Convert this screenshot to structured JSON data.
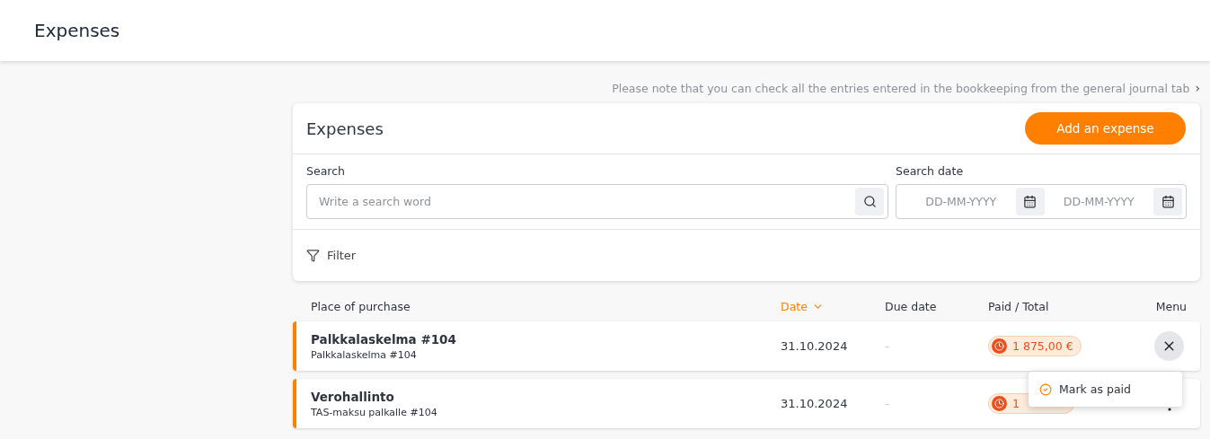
{
  "header": {
    "title": "Expenses"
  },
  "notice": {
    "text": "Please note that you can check all the entries entered in the bookkeeping from the general journal tab",
    "chevron": "›"
  },
  "card": {
    "title": "Expenses",
    "add_button": "Add an expense",
    "search": {
      "label": "Search",
      "placeholder": "Write a search word"
    },
    "search_date": {
      "label": "Search date",
      "from_placeholder": "DD-MM-YYYY",
      "to_placeholder": "DD-MM-YYYY"
    },
    "filter": "Filter"
  },
  "table": {
    "columns": [
      {
        "label": "Place of purchase",
        "sorted": false
      },
      {
        "label": "Date",
        "sorted": true
      },
      {
        "label": "Due date",
        "sorted": false
      },
      {
        "label": "Paid / Total",
        "sorted": false
      },
      {
        "label": "Menu",
        "sorted": false
      }
    ],
    "rows": [
      {
        "title": "Palkkalaskelma #104",
        "subtitle": "Palkkalaskelma #104",
        "date": "31.10.2024",
        "due_date": "-",
        "amount": "1 875,00 €",
        "menu_open": true
      },
      {
        "title": "Verohallinto",
        "subtitle": "TAS-maksu palkalle #104",
        "date": "31.10.2024",
        "due_date": "-",
        "amount": "1",
        "menu_open": false
      }
    ]
  },
  "popup_menu": {
    "items": [
      "Mark as paid"
    ]
  }
}
